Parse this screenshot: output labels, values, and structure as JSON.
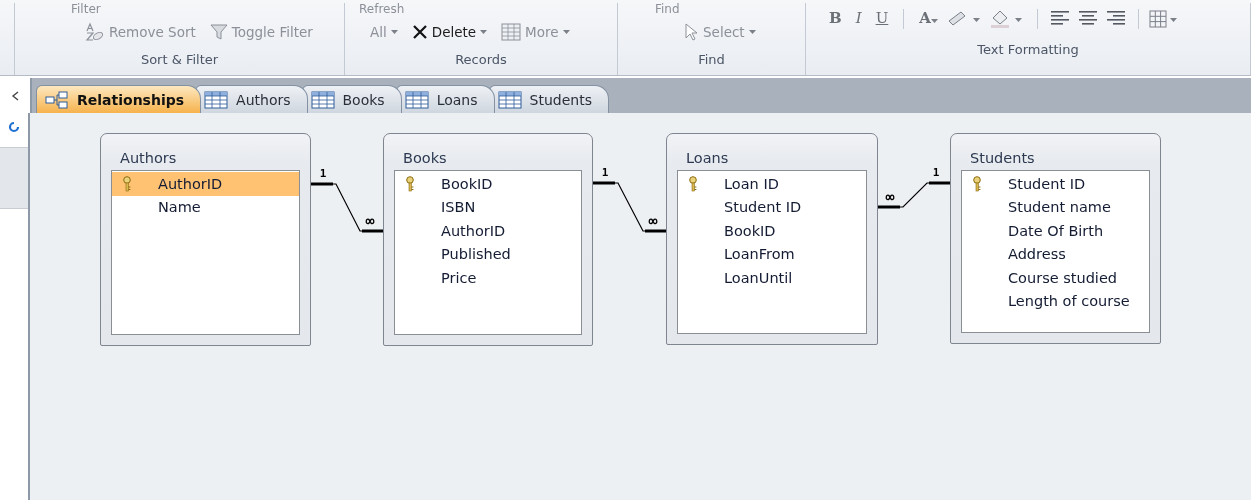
{
  "ribbon": {
    "groups": [
      {
        "kind": "sort_filter",
        "label": "Sort & Filter",
        "top_texts": [
          "Filter"
        ],
        "buttons": [
          {
            "label": "Remove Sort",
            "disabled": true,
            "dropdown": false
          },
          {
            "label": "Toggle Filter",
            "disabled": true,
            "dropdown": false
          }
        ]
      },
      {
        "kind": "records",
        "label": "Records",
        "top_texts": [
          "Refresh"
        ],
        "buttons": [
          {
            "label": "All",
            "disabled": true,
            "dropdown": true
          },
          {
            "label": "Delete",
            "disabled": false,
            "dropdown": true
          },
          {
            "label": "More",
            "disabled": true,
            "dropdown": true
          }
        ]
      },
      {
        "kind": "find",
        "label": "Find",
        "top_texts": [
          "Find"
        ],
        "buttons": [
          {
            "label": "Select",
            "disabled": true,
            "dropdown": true
          }
        ]
      },
      {
        "kind": "text_formatting",
        "label": "Text Formatting",
        "buttons": [
          {
            "label": "B",
            "disabled": true,
            "dropdown": false
          },
          {
            "label": "I",
            "disabled": true,
            "dropdown": false
          },
          {
            "label": "U",
            "disabled": true,
            "dropdown": false
          },
          {
            "label": "A",
            "disabled": true,
            "dropdown": true
          }
        ]
      }
    ]
  },
  "tabs": [
    {
      "label": "Relationships",
      "kind": "relationships",
      "selected": true
    },
    {
      "label": "Authors",
      "kind": "table",
      "selected": false
    },
    {
      "label": "Books",
      "kind": "table",
      "selected": false
    },
    {
      "label": "Loans",
      "kind": "table",
      "selected": false
    },
    {
      "label": "Students",
      "kind": "table",
      "selected": false
    }
  ],
  "tables": [
    {
      "title": "Authors",
      "fields": [
        {
          "name": "AuthorID",
          "primary_key": true,
          "selected": true
        },
        {
          "name": "Name",
          "primary_key": false,
          "selected": false
        }
      ]
    },
    {
      "title": "Books",
      "fields": [
        {
          "name": "BookID",
          "primary_key": true,
          "selected": false
        },
        {
          "name": "ISBN",
          "primary_key": false,
          "selected": false
        },
        {
          "name": "AuthorID",
          "primary_key": false,
          "selected": false
        },
        {
          "name": "Published",
          "primary_key": false,
          "selected": false
        },
        {
          "name": "Price",
          "primary_key": false,
          "selected": false
        }
      ]
    },
    {
      "title": "Loans",
      "fields": [
        {
          "name": "Loan ID",
          "primary_key": true,
          "selected": false
        },
        {
          "name": "Student ID",
          "primary_key": false,
          "selected": false
        },
        {
          "name": "BookID",
          "primary_key": false,
          "selected": false
        },
        {
          "name": "LoanFrom",
          "primary_key": false,
          "selected": false
        },
        {
          "name": "LoanUntil",
          "primary_key": false,
          "selected": false
        }
      ]
    },
    {
      "title": "Students",
      "fields": [
        {
          "name": "Student ID",
          "primary_key": true,
          "selected": false
        },
        {
          "name": "Student name",
          "primary_key": false,
          "selected": false
        },
        {
          "name": "Date Of Birth",
          "primary_key": false,
          "selected": false
        },
        {
          "name": "Address",
          "primary_key": false,
          "selected": false
        },
        {
          "name": "Course studied",
          "primary_key": false,
          "selected": false
        },
        {
          "name": "Length of course",
          "primary_key": false,
          "selected": false
        }
      ]
    }
  ],
  "relationships": [
    {
      "one_end": "1",
      "many_end": "∞"
    },
    {
      "one_end": "1",
      "many_end": "∞"
    },
    {
      "one_end": "1",
      "many_end": "∞"
    }
  ]
}
